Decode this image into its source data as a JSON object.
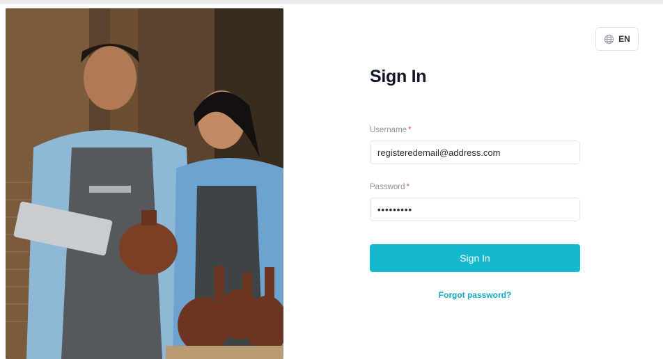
{
  "language": {
    "label": "EN",
    "icon": "globe-icon"
  },
  "form": {
    "title": "Sign In",
    "username": {
      "label": "Username",
      "required_mark": "*",
      "value": "registeredemail@address.com"
    },
    "password": {
      "label": "Password",
      "required_mark": "*",
      "value": "•••••••••"
    },
    "submit_label": "Sign In",
    "forgot_label": "Forgot password?"
  },
  "colors": {
    "accent": "#16b8cf",
    "link": "#13aac2",
    "required": "#e5484d",
    "title": "#101828"
  }
}
